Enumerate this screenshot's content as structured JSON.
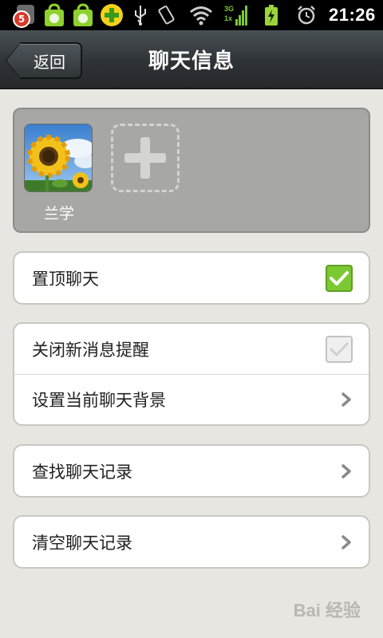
{
  "status_bar": {
    "notification_count": "5",
    "time": "21:26",
    "network_top": "3G",
    "network_bottom": "1x",
    "icons": [
      "notification-badge-icon",
      "store-bag-icon",
      "store-bag-icon",
      "plus-app-icon",
      "usb-icon",
      "vibrate-icon",
      "wifi-icon",
      "signal-icon",
      "battery-charging-icon",
      "alarm-icon"
    ]
  },
  "header": {
    "back_label": "返回",
    "title": "聊天信息"
  },
  "members": {
    "items": [
      {
        "name": "兰学",
        "avatar": "sunflower-avatar"
      }
    ],
    "add_icon": "plus-icon"
  },
  "groups": [
    {
      "rows": [
        {
          "label": "置顶聊天",
          "control": "checkbox",
          "checked": true
        }
      ]
    },
    {
      "rows": [
        {
          "label": "关闭新消息提醒",
          "control": "checkbox",
          "checked": false
        },
        {
          "label": "设置当前聊天背景",
          "control": "chevron"
        }
      ]
    },
    {
      "rows": [
        {
          "label": "查找聊天记录",
          "control": "chevron"
        }
      ]
    },
    {
      "rows": [
        {
          "label": "清空聊天记录",
          "control": "chevron"
        }
      ]
    }
  ],
  "colors": {
    "accent_green": "#7cc832",
    "background": "#e8e6e1",
    "titlebar": "#2d3236"
  },
  "watermark": "Bai 经验"
}
